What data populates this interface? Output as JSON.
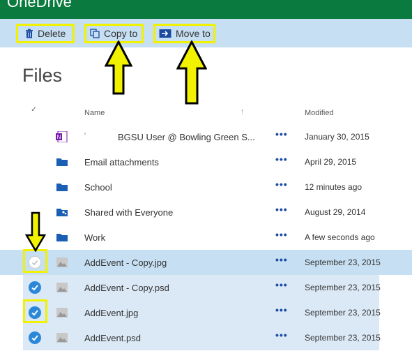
{
  "app": {
    "title": "OneDrive",
    "bar_color": "#0b7a3e"
  },
  "toolbar": {
    "delete_label": "Delete",
    "copy_label": "Copy to",
    "move_label": "Move to",
    "delete_icon": "trash-icon",
    "copy_icon": "copy-icon",
    "move_icon": "move-icon"
  },
  "page": {
    "title": "Files"
  },
  "columns": {
    "check": "✓",
    "name": "Name",
    "sort": "↑",
    "modified": "Modified"
  },
  "files": [
    {
      "name": "BGSU User @ Bowling Green S...",
      "modified": "January 30, 2015",
      "icon": "onenote-icon",
      "selected": false,
      "name_prefix": "'"
    },
    {
      "name": "Email attachments",
      "modified": "April 29, 2015",
      "icon": "folder-icon",
      "selected": false
    },
    {
      "name": "School",
      "modified": "12 minutes ago",
      "icon": "folder-icon",
      "selected": false
    },
    {
      "name": "Shared with Everyone",
      "modified": "August 29, 2014",
      "icon": "shared-folder-icon",
      "selected": false
    },
    {
      "name": "Work",
      "modified": "A few seconds ago",
      "icon": "folder-icon",
      "selected": false
    },
    {
      "name": "AddEvent - Copy.jpg",
      "modified": "September 23, 2015",
      "icon": "image-icon",
      "selected": false
    },
    {
      "name": "AddEvent - Copy.psd",
      "modified": "September 23, 2015",
      "icon": "image-icon",
      "selected": true
    },
    {
      "name": "AddEvent.jpg",
      "modified": "September 23, 2015",
      "icon": "image-icon",
      "selected": true
    },
    {
      "name": "AddEvent.psd",
      "modified": "September 23, 2015",
      "icon": "image-icon",
      "selected": true
    }
  ],
  "more_label": "•••",
  "colors": {
    "command_bar": "#c6dff2",
    "selected_row": "#dbe9f6",
    "highlight": "#f1f100",
    "check_blue": "#2b88d8"
  }
}
